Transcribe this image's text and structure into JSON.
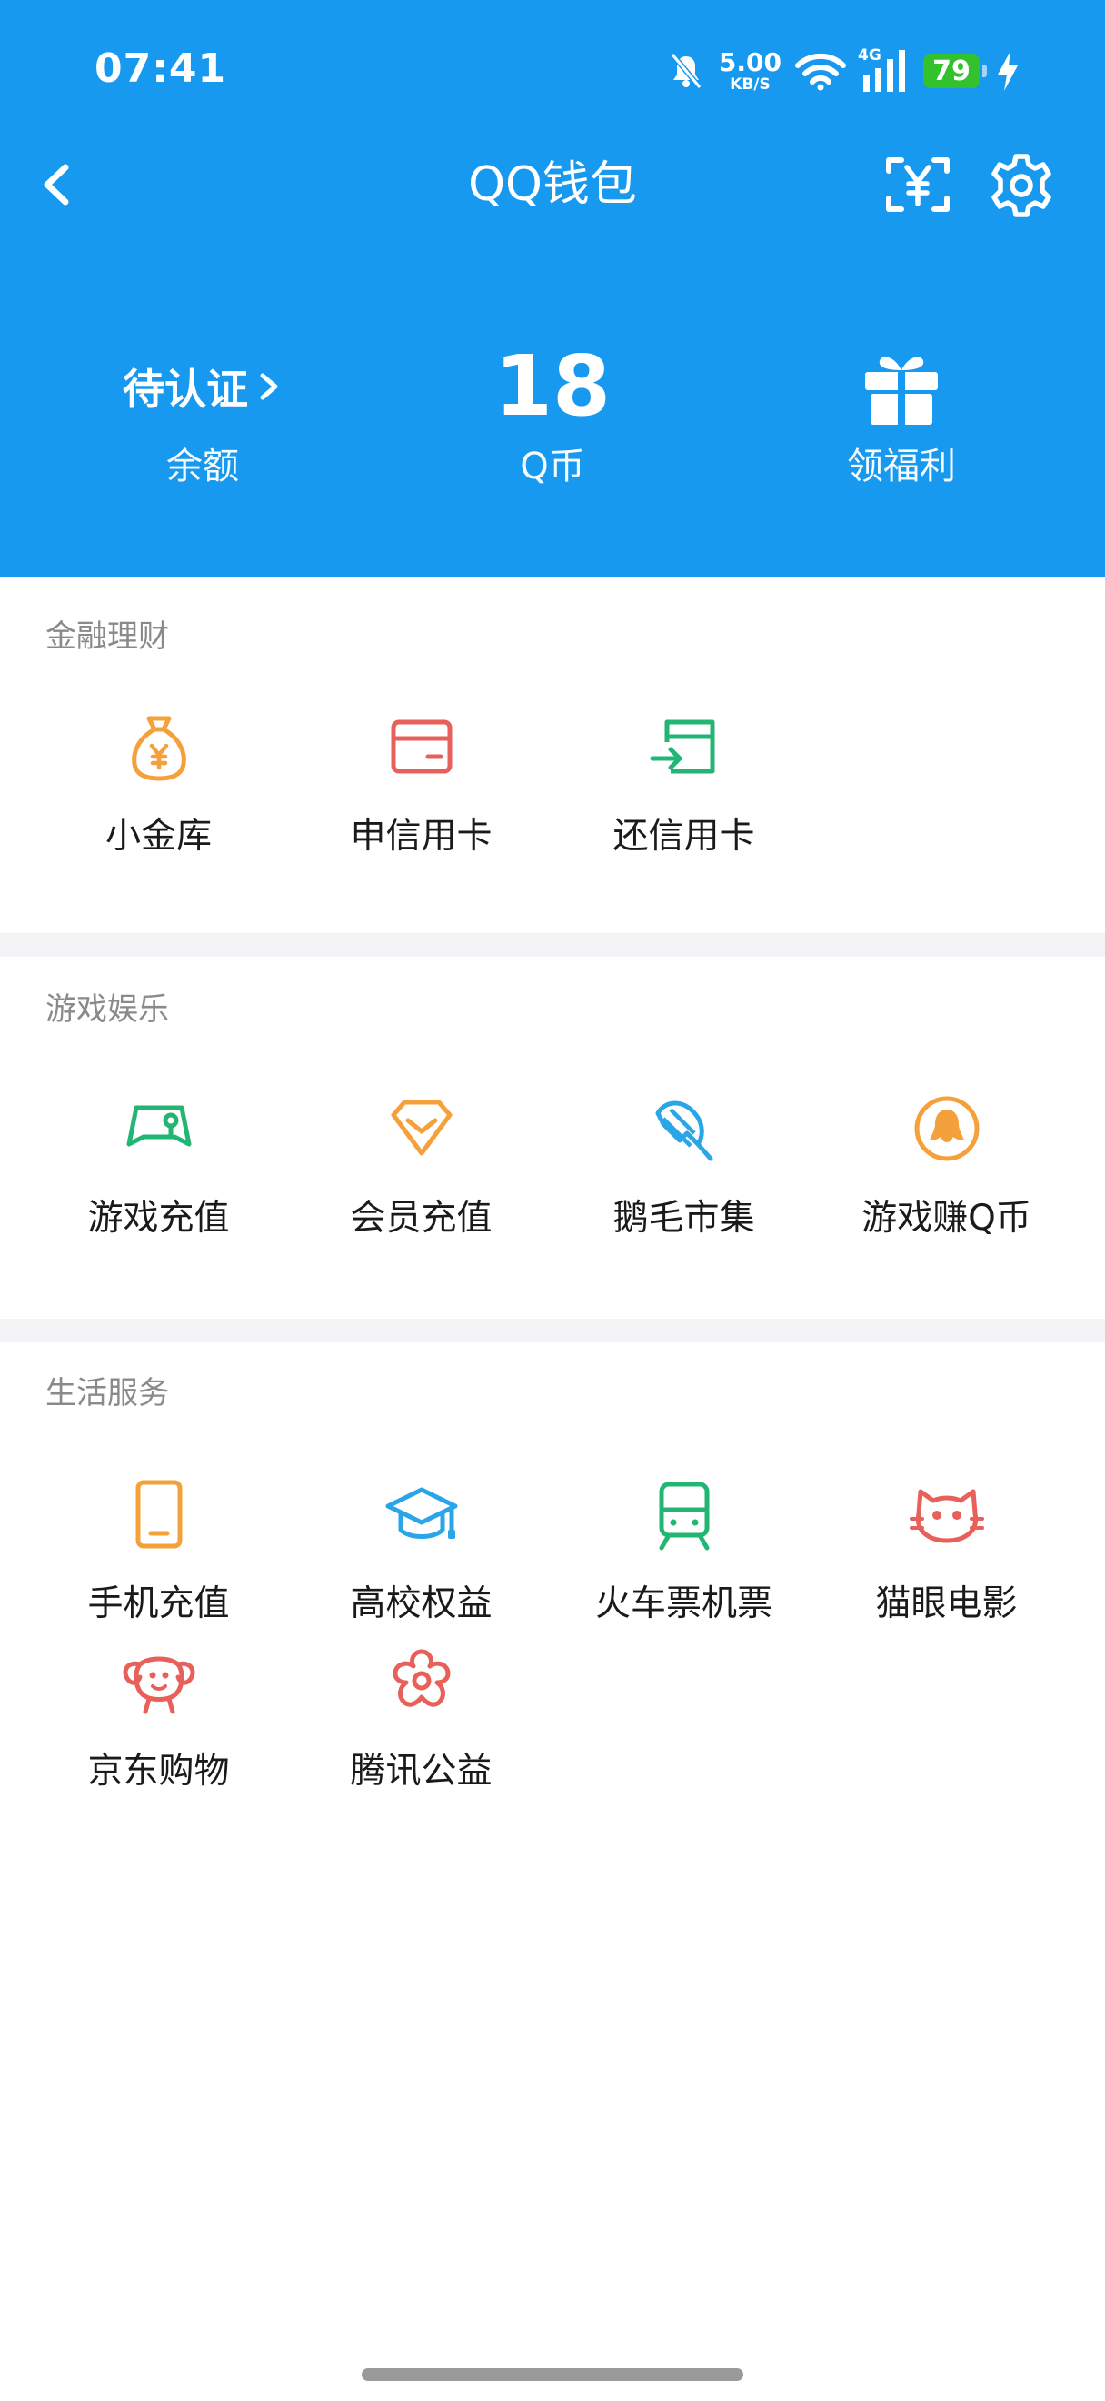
{
  "status_bar": {
    "time": "07:41",
    "net_speed": "5.00",
    "net_unit": "KB/S",
    "network": "4G",
    "battery": "79"
  },
  "nav": {
    "title": "QQ钱包"
  },
  "header": {
    "balance": {
      "value": "待认证",
      "label": "余额"
    },
    "qcoins": {
      "value": "18",
      "label": "Q币"
    },
    "benefits": {
      "label": "领福利"
    }
  },
  "sections": {
    "finance": {
      "title": "金融理财",
      "items": [
        {
          "label": "小金库",
          "icon": "money-bag-icon",
          "color": "#f5a13b"
        },
        {
          "label": "申信用卡",
          "icon": "credit-card-icon",
          "color": "#e8605a"
        },
        {
          "label": "还信用卡",
          "icon": "card-repay-icon",
          "color": "#22b573"
        }
      ]
    },
    "entertainment": {
      "title": "游戏娱乐",
      "items": [
        {
          "label": "游戏充值",
          "icon": "gamepad-icon",
          "color": "#22b573"
        },
        {
          "label": "会员充值",
          "icon": "diamond-icon",
          "color": "#f5a13b"
        },
        {
          "label": "鹅毛市集",
          "icon": "feather-icon",
          "color": "#2aa6e8"
        },
        {
          "label": "游戏赚Q币",
          "icon": "penguin-icon",
          "color": "#f5a13b"
        }
      ]
    },
    "life": {
      "title": "生活服务",
      "items": [
        {
          "label": "手机充值",
          "icon": "phone-icon",
          "color": "#f5a13b"
        },
        {
          "label": "高校权益",
          "icon": "graduation-cap-icon",
          "color": "#2aa6e8"
        },
        {
          "label": "火车票机票",
          "icon": "train-icon",
          "color": "#22b573"
        },
        {
          "label": "猫眼电影",
          "icon": "cat-icon",
          "color": "#e8605a"
        },
        {
          "label": "京东购物",
          "icon": "dog-icon",
          "color": "#e8605a"
        },
        {
          "label": "腾讯公益",
          "icon": "flower-icon",
          "color": "#e8605a"
        }
      ]
    }
  }
}
